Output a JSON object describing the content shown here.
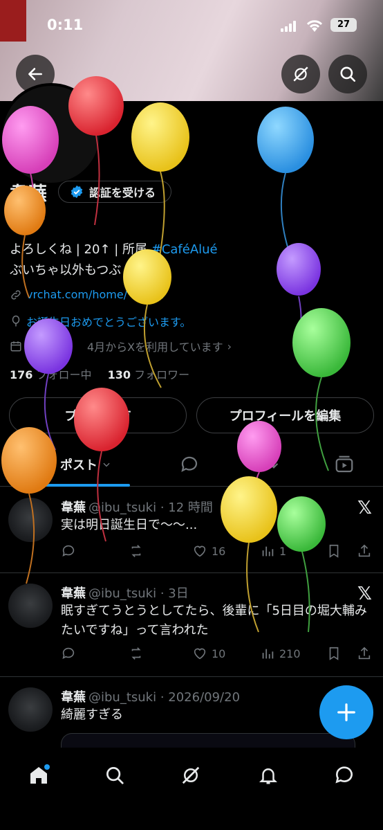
{
  "status_bar": {
    "time": "0:11",
    "battery": "27"
  },
  "profile": {
    "name": "韋蕪",
    "verify_label": "認証を受ける",
    "handle": "_tsuki",
    "bio_line1_prefix": "よろしくね | 20↑ | 所属 ",
    "bio_hashtag": "#CaféAlué",
    "bio_line2": "ぶいちゃ以外もつぶ        ます",
    "link": "vrchat.com/home/     usr_...",
    "birthday_text": "お誕生日おめでとうございます。",
    "joined": "4月からXを利用しています",
    "following_count": "176",
    "following_label": "フォロー中",
    "followers_count": "130",
    "followers_label": "フォロワー",
    "share_label": "プロフ         共有",
    "edit_label": "プロフィールを編集"
  },
  "tabs": {
    "posts": "ポスト"
  },
  "posts": [
    {
      "name": "韋蕪",
      "meta": "@ibu_tsuki · 12 時間",
      "text": "実は明日誕生日で〜〜...",
      "likes": "16",
      "views": "1"
    },
    {
      "name": "韋蕪",
      "meta": "@ibu_tsuki · 3日",
      "text": "眠すぎてうとうとしてたら、後輩に「5日目の堀大輔みたいですね」って言われた",
      "likes": "10",
      "views": "210"
    },
    {
      "name": "韋蕪",
      "meta": "@ibu_tsuki · 2026/09/20",
      "text": "綺麗すぎる"
    }
  ],
  "colors": {
    "accent": "#1d9bf0",
    "background": "#000000",
    "muted": "#71767b"
  },
  "icons": [
    "back-arrow-icon",
    "grok-icon",
    "search-icon",
    "verified-badge-icon",
    "link-icon",
    "balloon-icon",
    "calendar-icon",
    "reply-icon",
    "repost-icon",
    "like-icon",
    "views-icon",
    "bookmark-icon",
    "share-icon",
    "x-logo-icon",
    "compose-plus-icon",
    "home-icon",
    "notifications-icon",
    "messages-icon"
  ]
}
